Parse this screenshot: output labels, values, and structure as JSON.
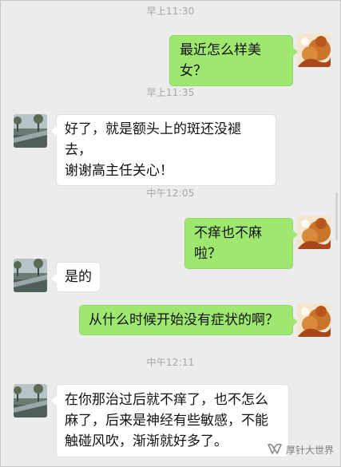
{
  "messages": [
    {
      "type": "time",
      "text": "早上11:30"
    },
    {
      "type": "msg",
      "side": "right",
      "text": "最近怎么样美女？",
      "avatar": "autumn-leaves-avatar"
    },
    {
      "type": "time",
      "text": "早上11:35"
    },
    {
      "type": "msg",
      "side": "left",
      "lines": [
        "好了，就是额头上的斑还没褪去，",
        "谢谢高主任关心！"
      ],
      "avatar": "lakeside-park-avatar"
    },
    {
      "type": "time",
      "text": "中午12:05"
    },
    {
      "type": "msg",
      "side": "right",
      "text": "不痒也不麻啦？",
      "avatar": "autumn-leaves-avatar"
    },
    {
      "type": "msg",
      "side": "left",
      "text": "是的",
      "avatar": "lakeside-park-avatar"
    },
    {
      "type": "msg",
      "side": "right",
      "text": "从什么时候开始没有症状的啊？",
      "avatar": "autumn-leaves-avatar"
    },
    {
      "type": "time",
      "text": "中午12:11"
    },
    {
      "type": "msg",
      "side": "left",
      "lines": [
        "在你那治过后就不痒了，也不怎么",
        "麻了，后来是神经有些敏感，不能",
        "触碰风吹，渐渐就好多了。"
      ],
      "avatar": "lakeside-park-avatar"
    }
  ],
  "watermark": {
    "text": "厚针大世界",
    "icon": "wechat-channel-icon"
  },
  "colors": {
    "sent_bubble": "#9fe870",
    "received_bubble": "#ffffff",
    "background": "#ececec",
    "timestamp": "#a6a6a6"
  }
}
